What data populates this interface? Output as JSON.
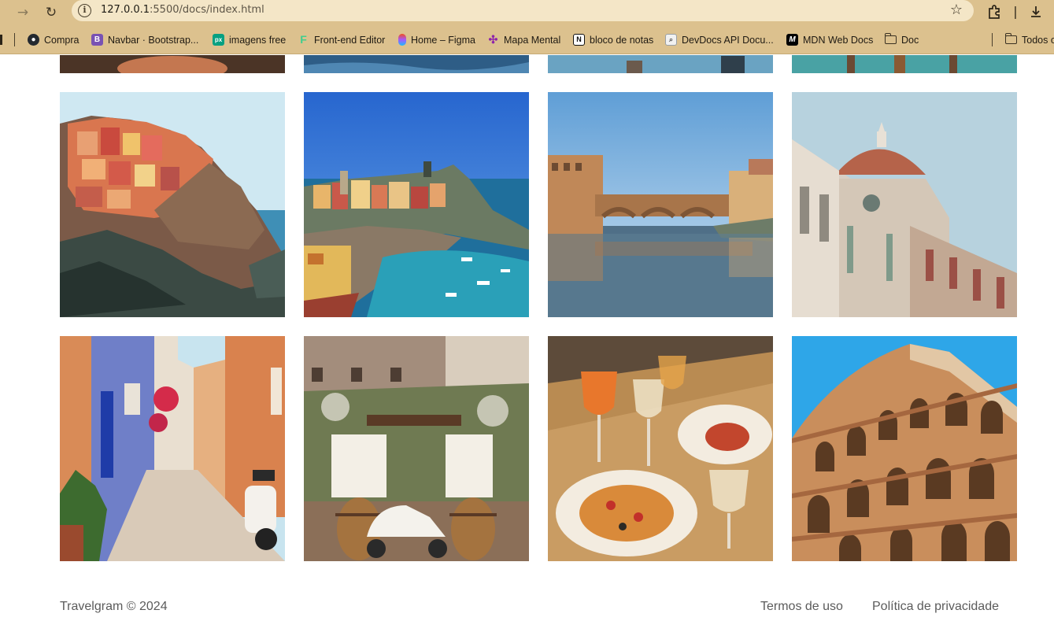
{
  "browser": {
    "url_host": "127.0.0.1",
    "url_path": ":5500/docs/index.html"
  },
  "bookmarks": [
    {
      "label": "Compra",
      "icon": "github-icon",
      "color": "#24292f"
    },
    {
      "label": "Navbar · Bootstrap...",
      "icon": "bootstrap-icon",
      "color": "#7952b3"
    },
    {
      "label": "imagens free",
      "icon": "pexels-icon",
      "color": "#05a081"
    },
    {
      "label": "Front-end Editor",
      "icon": "frontend-editor-icon",
      "color": "#3fcf8e"
    },
    {
      "label": "Home – Figma",
      "icon": "figma-icon",
      "color": "#f24e1e"
    },
    {
      "label": "Mapa Mental",
      "icon": "mind-map-icon",
      "color": "#8e24aa"
    },
    {
      "label": "bloco de notas",
      "icon": "notion-icon",
      "color": "#111111"
    },
    {
      "label": "DevDocs API Docu...",
      "icon": "devdocs-icon",
      "color": "#9aa0a6"
    },
    {
      "label": "MDN Web Docs",
      "icon": "mdn-icon",
      "color": "#000000"
    },
    {
      "label": "Doc",
      "icon": "folder-icon",
      "color": ""
    }
  ],
  "other_bookmarks": "Todos o",
  "gallery": {
    "rows": [
      {
        "tiles": [
          {
            "alt": "cinque-terre-cliff-village",
            "palette": [
              "#c9e6f1",
              "#d9764f",
              "#6a5445",
              "#2f3f3a"
            ]
          },
          {
            "alt": "vernazza-harbor",
            "palette": [
              "#2f6fd6",
              "#e8b56a",
              "#2aa0b8",
              "#6b7a63"
            ]
          },
          {
            "alt": "ponte-vecchio-florence",
            "palette": [
              "#9cc4e8",
              "#c08858",
              "#6d7c68",
              "#4f6f87"
            ]
          },
          {
            "alt": "florence-cathedral-dome",
            "palette": [
              "#b7d2de",
              "#b5634a",
              "#d8cfc4",
              "#8f8a80"
            ]
          }
        ]
      },
      {
        "tiles": [
          {
            "alt": "colorful-alley-with-vespa",
            "palette": [
              "#c8e4ef",
              "#d98b57",
              "#6f7fc8",
              "#d9cab8"
            ]
          },
          {
            "alt": "restaurant-with-vespa-and-barrels",
            "palette": [
              "#c9d7d9",
              "#8b6f58",
              "#e9e6dd",
              "#a4733f"
            ]
          },
          {
            "alt": "aperol-and-seafood-pasta",
            "palette": [
              "#5d4b3a",
              "#e8772c",
              "#f3ece0",
              "#b98b52"
            ]
          },
          {
            "alt": "rome-colosseum",
            "palette": [
              "#2ea6e8",
              "#c98e5c",
              "#a5673f",
              "#e2c7a5"
            ]
          }
        ]
      }
    ]
  },
  "footer": {
    "copyright": "Travelgram © 2024",
    "links": [
      "Termos de uso",
      "Política de privacidade"
    ]
  }
}
